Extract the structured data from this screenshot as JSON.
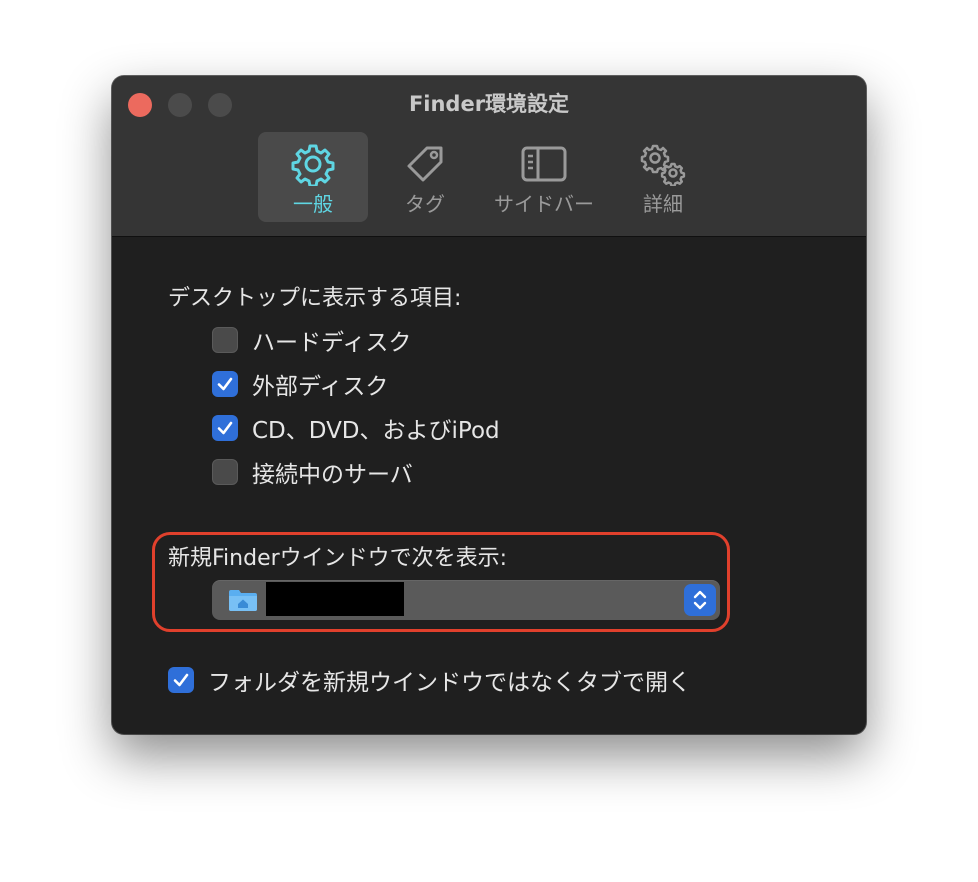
{
  "window": {
    "title": "Finder環境設定"
  },
  "toolbar": {
    "tabs": [
      {
        "label": "一般",
        "icon": "gear-icon",
        "active": true
      },
      {
        "label": "タグ",
        "icon": "tag-icon",
        "active": false
      },
      {
        "label": "サイドバー",
        "icon": "sidebar-icon",
        "active": false
      },
      {
        "label": "詳細",
        "icon": "gears-icon",
        "active": false
      }
    ]
  },
  "desktop": {
    "heading": "デスクトップに表示する項目:",
    "items": [
      {
        "label": "ハードディスク",
        "checked": false
      },
      {
        "label": "外部ディスク",
        "checked": true
      },
      {
        "label": "CD、DVD、およびiPod",
        "checked": true
      },
      {
        "label": "接続中のサーバ",
        "checked": false
      }
    ]
  },
  "new_window": {
    "heading": "新規Finderウインドウで次を表示:",
    "selected_icon": "home-folder-icon"
  },
  "tabs_option": {
    "label": "フォルダを新規ウインドウではなくタブで開く",
    "checked": true
  },
  "colors": {
    "accent": "#2f6fd9",
    "active_tab_icon": "#5fd6e3",
    "highlight_border": "#e0402c",
    "close_button": "#ec6a5e"
  }
}
